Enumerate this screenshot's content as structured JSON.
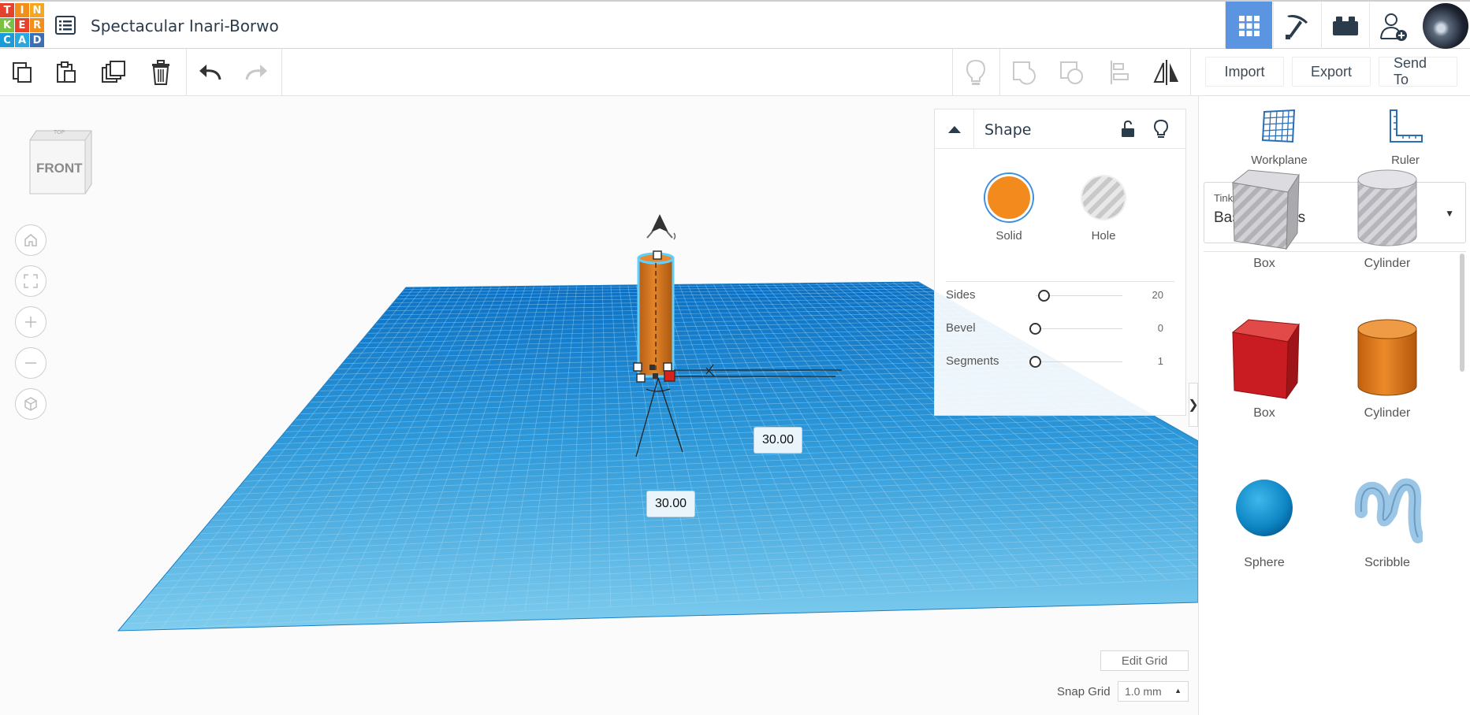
{
  "app": {
    "logo_letters": [
      "T",
      "I",
      "N",
      "K",
      "E",
      "R",
      "C",
      "A",
      "D"
    ],
    "logo_colors": [
      "#e6412b",
      "#f28e1c",
      "#f5a623",
      "#7ac142",
      "#e6412b",
      "#f28e1c",
      "#1b9bd7",
      "#26a9e0",
      "#3d6fb6"
    ],
    "doc_title": "Spectacular Inari-Borwo"
  },
  "topnav": {
    "items": [
      {
        "name": "3d-design",
        "icon": "grid-icon",
        "active": true
      },
      {
        "name": "codeblocks",
        "icon": "pickaxe-icon",
        "active": false
      },
      {
        "name": "bricks",
        "icon": "brick-icon",
        "active": false
      },
      {
        "name": "user",
        "icon": "add-user-icon",
        "active": false
      }
    ],
    "accent": "#5b94e0"
  },
  "toolbar": {
    "import_label": "Import",
    "export_label": "Export",
    "send_to_label": "Send To"
  },
  "viewcube": {
    "front_label": "FRONT",
    "top_label": "TOP"
  },
  "scene": {
    "dimension_width": "30.00",
    "dimension_depth": "30.00",
    "shape_color": "#d2741e",
    "workplane_color": "#2e9bd8"
  },
  "shape_panel": {
    "title": "Shape",
    "solid_label": "Solid",
    "hole_label": "Hole",
    "solid_color": "#f28a1e",
    "props": [
      {
        "name": "Sides",
        "value": "20",
        "fraction": 0.1
      },
      {
        "name": "Bevel",
        "value": "0",
        "fraction": 0.0
      },
      {
        "name": "Segments",
        "value": "1",
        "fraction": 0.0
      }
    ]
  },
  "sidebar": {
    "workplane_label": "Workplane",
    "ruler_label": "Ruler",
    "library_source": "Tinkercad",
    "library_name": "Basic Shapes",
    "shapes": [
      {
        "label": "Box",
        "kind": "box-hole"
      },
      {
        "label": "Cylinder",
        "kind": "cylinder-hole"
      },
      {
        "label": "Box",
        "kind": "box-solid"
      },
      {
        "label": "Cylinder",
        "kind": "cylinder-solid"
      },
      {
        "label": "Sphere",
        "kind": "sphere"
      },
      {
        "label": "Scribble",
        "kind": "scribble"
      }
    ]
  },
  "grid": {
    "edit_grid_label": "Edit Grid",
    "snap_grid_label": "Snap Grid",
    "snap_grid_value": "1.0 mm"
  }
}
